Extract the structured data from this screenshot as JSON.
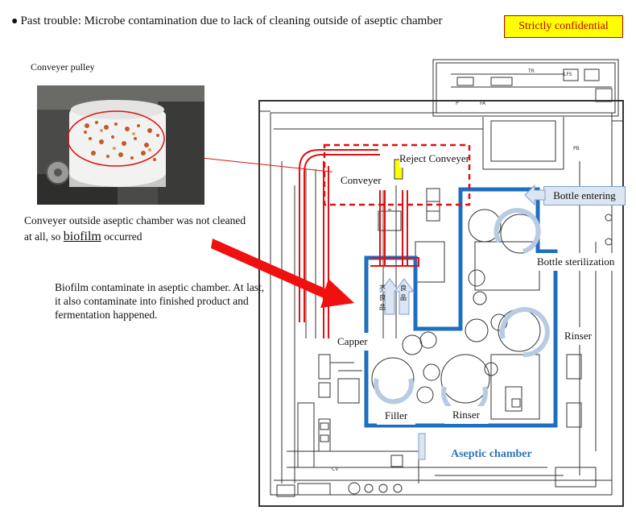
{
  "title": "Past trouble: Microbe contamination due to lack of cleaning outside of aseptic chamber",
  "confidential": "Strictly confidential",
  "photo_label": "Conveyer pulley",
  "conveyor_note_pre": "Conveyer outside aseptic chamber was not cleaned at all, so ",
  "conveyor_note_word": "biofilm",
  "conveyor_note_post": " occurred",
  "contaminate_note": "Biofilm contaminate in aseptic chamber. At last, it also contaminate into finished product and fermentation happened.",
  "labels": {
    "conveyer": "Conveyer",
    "reject_conveyer": "Reject Conveyer",
    "bottle_entering": "Bottle entering",
    "bottle_sterilization": "Bottle sterilization",
    "capper": "Capper",
    "rinser_right": "Rinser",
    "filler": "Filler",
    "rinser_bottom": "Rinser",
    "aseptic_chamber": "Aseptic chamber"
  },
  "colors": {
    "aseptic_outline": "#1f6fc0",
    "conveyor_red": "#e01010",
    "arrow_blue": "#b8cbe4",
    "confidential_bg": "#ffff00",
    "confidential_text": "#c00000"
  }
}
